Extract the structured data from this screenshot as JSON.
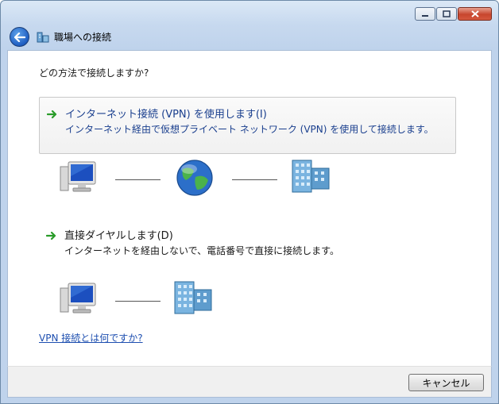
{
  "window": {
    "title": "職場への接続",
    "controls": [
      "minimize-icon",
      "maximize-icon",
      "close-icon"
    ]
  },
  "content": {
    "prompt": "どの方法で接続しますか?",
    "options": [
      {
        "title": "インターネット接続 (VPN) を使用します(I)",
        "description": "インターネット経由で仮想プライベート ネットワーク (VPN) を使用して接続します。",
        "icon": "green-arrow-icon",
        "selected": true
      },
      {
        "title": "直接ダイヤルします(D)",
        "description": "インターネットを経由しないで、電話番号で直接に接続します。",
        "icon": "green-arrow-icon",
        "selected": false
      }
    ],
    "help_link": "VPN 接続とは何ですか?"
  },
  "footer": {
    "cancel_label": "キャンセル"
  },
  "colors": {
    "link": "#1e4fb0",
    "option_text": "#1a3f8e",
    "arrow": "#2a9c2a"
  }
}
